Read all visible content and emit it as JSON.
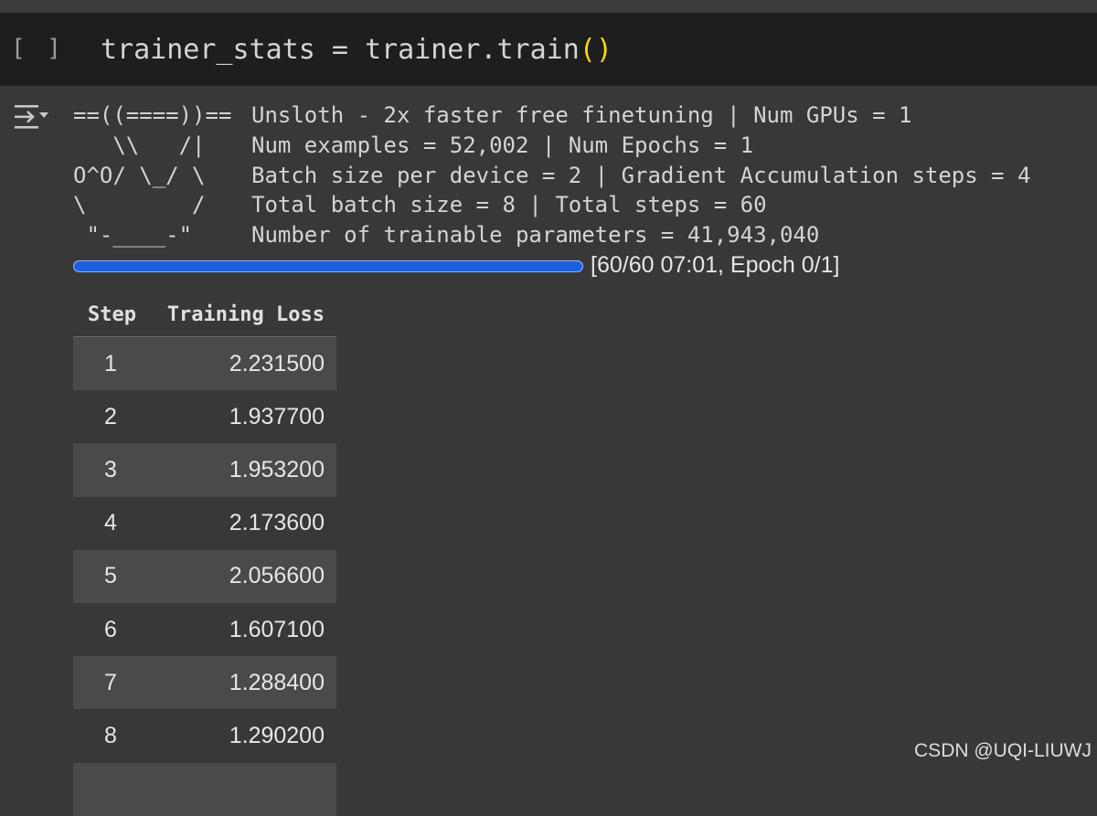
{
  "code_cell": {
    "run_indicator": "[ ]",
    "code_prefix": "trainer_stats = trainer.train",
    "code_parens": "()"
  },
  "output": {
    "icon": "output-toggle-icon",
    "banner": [
      {
        "art": "==((====))==",
        "text": "Unsloth - 2x faster free finetuning | Num GPUs = 1"
      },
      {
        "art": "   \\\\   /|",
        "text": "Num examples = 52,002 | Num Epochs = 1"
      },
      {
        "art": "O^O/ \\_/ \\",
        "text": "Batch size per device = 2 | Gradient Accumulation steps = 4"
      },
      {
        "art": "\\        /",
        "text": "Total batch size = 8 | Total steps = 60"
      },
      {
        "art": " \"-____-\"",
        "text": "Number of trainable parameters = 41,943,040"
      }
    ],
    "progress": {
      "value": 60,
      "max": 60,
      "label": "[60/60 07:01, Epoch 0/1]"
    },
    "table": {
      "headers": [
        "Step",
        "Training Loss"
      ],
      "rows": [
        {
          "step": "1",
          "loss": "2.231500"
        },
        {
          "step": "2",
          "loss": "1.937700"
        },
        {
          "step": "3",
          "loss": "1.953200"
        },
        {
          "step": "4",
          "loss": "2.173600"
        },
        {
          "step": "5",
          "loss": "2.056600"
        },
        {
          "step": "6",
          "loss": "1.607100"
        },
        {
          "step": "7",
          "loss": "1.288400"
        },
        {
          "step": "8",
          "loss": "1.290200"
        },
        {
          "step": "",
          "loss": ""
        }
      ]
    }
  },
  "watermark": "CSDN @UQI-LIUWJ",
  "colors": {
    "page_bg": "#383838",
    "code_bg": "#1e1e1e",
    "paren": "#ffd700",
    "progress_fill": "#1a5fe0",
    "row_alt": "#4a4a4a"
  }
}
